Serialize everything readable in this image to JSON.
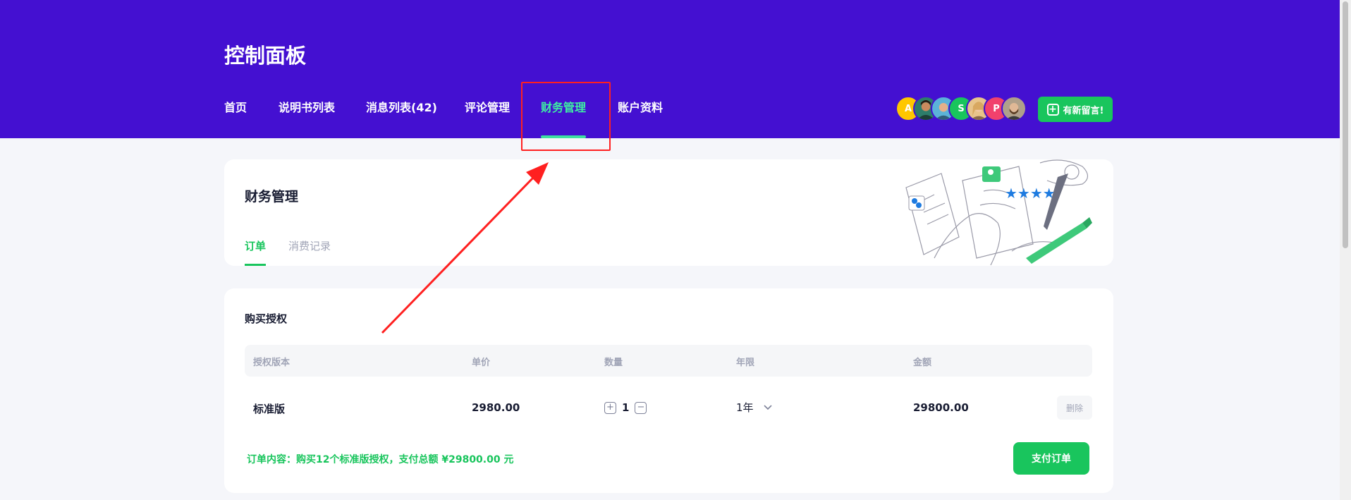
{
  "header": {
    "title": "控制面板",
    "nav": [
      {
        "label": "首页",
        "active": false
      },
      {
        "label": "说明书列表",
        "active": false
      },
      {
        "label": "消息列表(42)",
        "active": false
      },
      {
        "label": "评论管理",
        "active": false
      },
      {
        "label": "财务管理",
        "active": true
      },
      {
        "label": "账户资料",
        "active": false
      }
    ],
    "avatars": [
      {
        "letter": "A",
        "color": "#ffc700"
      },
      {
        "letter": "",
        "color": "#2d7d6a"
      },
      {
        "letter": "",
        "color": "#5bb3d8"
      },
      {
        "letter": "S",
        "color": "#19c55d"
      },
      {
        "letter": "",
        "color": "#e8c48a"
      },
      {
        "letter": "P",
        "color": "#f1416c"
      },
      {
        "letter": "",
        "color": "#b0a08a"
      }
    ],
    "new_message_button": "有新留言!"
  },
  "finance_card": {
    "title": "财务管理",
    "tabs": [
      {
        "label": "订单",
        "active": true
      },
      {
        "label": "消费记录",
        "active": false
      }
    ]
  },
  "purchase": {
    "title": "购买授权",
    "columns": [
      "授权版本",
      "单价",
      "数量",
      "年限",
      "金额"
    ],
    "row": {
      "version": "标准版",
      "unit_price": "2980.00",
      "quantity": "1",
      "duration": "1年",
      "amount": "29800.00",
      "delete_label": "删除"
    },
    "summary": "订单内容：购买12个标准版授权，支付总额 ¥29800.00 元",
    "pay_button": "支付订单"
  },
  "colors": {
    "header_bg": "#4410d1",
    "accent_green": "#19c55d",
    "active_nav": "#3ef0a2",
    "annotation_red": "#ff2020"
  }
}
